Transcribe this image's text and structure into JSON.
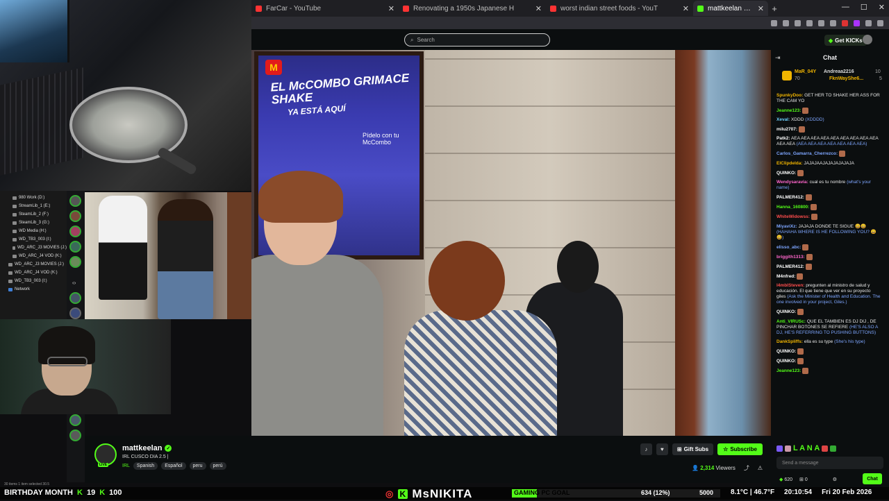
{
  "browser": {
    "tabs": [
      {
        "title": "FarCar - YouTube",
        "color": "#ff3333",
        "active": false
      },
      {
        "title": "Renovating a 1950s Japanese H",
        "color": "#ff3333",
        "active": false
      },
      {
        "title": "worst indian street foods - YouT",
        "color": "#ff3333",
        "active": false
      },
      {
        "title": "mattkeelan Stream - Watch",
        "color": "#53fc18",
        "active": true
      }
    ],
    "new_tab": "+",
    "window_controls": [
      "—",
      "☐",
      "✕"
    ]
  },
  "site": {
    "search_placeholder": "Search",
    "get_kicks_label": "Get KICKs"
  },
  "explorer": {
    "drives": [
      "980 Work (D:)",
      "StreamLib_1 (E:)",
      "SteamLib_2 (F:)",
      "SteamLib_3 (G:)",
      "WD Media (H:)",
      "WD_TB3_003 (I:)",
      "WD_ARC_J3 MOVIES (J:)",
      "WD_ARC_J4 VOD (K:)"
    ],
    "drives2": [
      "WD_ARC_J3 MOVIES (J:)",
      "WD_ARC_J4 VOD (K:)",
      "WD_TB3_003 (I:)"
    ],
    "network": "Network",
    "status": "30 items   1 item selected 30.5"
  },
  "video": {
    "poster_line1": "EL McCOMBO GRIMACE SHAKE",
    "poster_line2": "YA ESTÁ AQUÍ",
    "poster_small": "Pídelo con tu McCombo",
    "logo": "M"
  },
  "stream": {
    "username": "mattkeelan",
    "live_label": "LIVE",
    "title": "IRL CUSCO DIA 2.5 |",
    "category": "IRL",
    "tags": [
      "Spanish",
      "Español",
      "peru",
      "perú"
    ],
    "gift_label": "Gift Subs",
    "subscribe_label": "Subscribe",
    "viewers": "2,314",
    "viewers_label": "Viewers"
  },
  "chat": {
    "title": "Chat",
    "leaderboard": [
      {
        "name": "MaR_04Y",
        "value": "70"
      },
      {
        "name": "Andreaa2216",
        "value": "10"
      },
      {
        "name": "FknWayShe6...",
        "value": "5"
      }
    ],
    "messages": [
      {
        "user": "SpunkyDoo:",
        "color": "#f0b400",
        "text": "GET HER TO SHAKE HER ASS FOR THE CAM YO",
        "tr": ""
      },
      {
        "user": "Jeanne123:",
        "color": "#53fc18",
        "text": "",
        "tr": ""
      },
      {
        "user": "Xeval:",
        "color": "#6dd3ff",
        "text": "XDDD",
        "tr": "(XDDDD)"
      },
      {
        "user": "milu2707:",
        "color": "#ffffff",
        "text": "",
        "tr": ""
      },
      {
        "user": "Patk2:",
        "color": "#ffffff",
        "text": "AEA AEA AEA AEA AEA AEA AEA AEA AEA AEA AEA",
        "tr": "(AEA AEA AEA AEA AEA AEA AEA)"
      },
      {
        "user": "Carlos_Gamarra_Cherrezco:",
        "color": "#7ea6ff",
        "text": "",
        "tr": ""
      },
      {
        "user": "ElClipdelda:",
        "color": "#f0b400",
        "text": "JAJAJAAJAJAJAJAJAJA",
        "tr": ""
      },
      {
        "user": "QUINKO:",
        "color": "#ffffff",
        "text": "",
        "tr": ""
      },
      {
        "user": "Wendysaravia:",
        "color": "#ff66cc",
        "text": "cual es tu nombre",
        "tr": "(what's your name)"
      },
      {
        "user": "PALMER412:",
        "color": "#ffffff",
        "text": "",
        "tr": ""
      },
      {
        "user": "Hanna_160800:",
        "color": "#53fc18",
        "text": "",
        "tr": ""
      },
      {
        "user": "WhiteWidowss:",
        "color": "#ff4d4d",
        "text": "",
        "tr": ""
      },
      {
        "user": "MiyaviXz:",
        "color": "#7ea6ff",
        "text": "JAJAJA DONDE TE SIGUE 😀😀",
        "tr": "(HAHAHA WHERE IS HE FOLLOWING YOU? 😀😀)"
      },
      {
        "user": "elisso_abc:",
        "color": "#7ea6ff",
        "text": "",
        "tr": ""
      },
      {
        "user": "briggith1313:",
        "color": "#ff66cc",
        "text": "",
        "tr": ""
      },
      {
        "user": "PALMER412:",
        "color": "#ffffff",
        "text": "",
        "tr": ""
      },
      {
        "user": "M4nfred:",
        "color": "#ffffff",
        "text": "",
        "tr": ""
      },
      {
        "user": "l4mblSteven:",
        "color": "#ff4d4d",
        "text": "pregunten al ministro de salud y educación. El que tiene que ver en su proyecto giles",
        "tr": "(Ask the Minister of Health and Education. The one involved in your project, Giles.)"
      },
      {
        "user": "QUINKO:",
        "color": "#ffffff",
        "text": "",
        "tr": ""
      },
      {
        "user": "Anti_VIRUSc:",
        "color": "#53fc18",
        "text": "QUE EL TAMBIEN ES DJ DIJ , DE PINCHAR BOTONES SE REFIERE",
        "tr": "(HE'S ALSO A DJ, HE'S REFERRING TO PUSHING BUTTONS)"
      },
      {
        "user": "DankSpliffs:",
        "color": "#f0b400",
        "text": "ella es su type",
        "tr": "(She's his type)"
      },
      {
        "user": "QUINKO:",
        "color": "#ffffff",
        "text": "",
        "tr": ""
      },
      {
        "user": "QUINKO:",
        "color": "#ffffff",
        "text": "",
        "tr": ""
      },
      {
        "user": "Jeanne123:",
        "color": "#53fc18",
        "text": "",
        "tr": ""
      }
    ],
    "emote_text": "L A N A",
    "input_placeholder": "Send a message",
    "kicks_count": "620",
    "gift_count": "0",
    "chat_button": "Chat"
  },
  "overlay": {
    "left_label": "BIRTHDAY MONTH",
    "left_count1": "19",
    "left_count2": "100",
    "streamer_name": "MsNIKITA",
    "goal_label": "GAMING PC GOAL",
    "goal_progress": "634 (12%)",
    "goal_fraction": 0.12,
    "goal_target": "5000",
    "weather": "8.1°C | 46.7°F",
    "time": "20:10:54",
    "date": "Fri 20 Feb 2026"
  },
  "colors": {
    "accent": "#53fc18",
    "background": "#0e0e10"
  }
}
